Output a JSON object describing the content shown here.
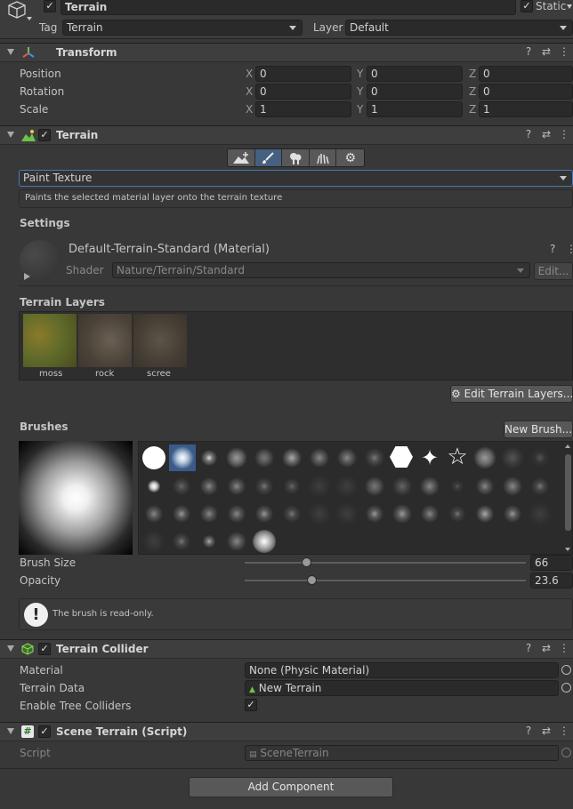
{
  "object": {
    "name": "Terrain",
    "static_label": "Static",
    "tag_label": "Tag",
    "tag_value": "Terrain",
    "layer_label": "Layer",
    "layer_value": "Default"
  },
  "transform": {
    "title": "Transform",
    "rows": [
      {
        "label": "Position",
        "x": "0",
        "y": "0",
        "z": "0"
      },
      {
        "label": "Rotation",
        "x": "0",
        "y": "0",
        "z": "0"
      },
      {
        "label": "Scale",
        "x": "1",
        "y": "1",
        "z": "1"
      }
    ],
    "axis_x": "X",
    "axis_y": "Y",
    "axis_z": "Z"
  },
  "terrain": {
    "title": "Terrain",
    "tool_dropdown": "Paint Texture",
    "tool_description": "Paints the selected material layer onto the terrain texture",
    "settings_label": "Settings",
    "material_name": "Default-Terrain-Standard (Material)",
    "shader_label": "Shader",
    "shader_value": "Nature/Terrain/Standard",
    "edit_label": "Edit...",
    "layers_label": "Terrain Layers",
    "layers": [
      {
        "name": "moss",
        "color": "#6b6a2a"
      },
      {
        "name": "rock",
        "color": "#5a5048"
      },
      {
        "name": "scree",
        "color": "#4e463c"
      }
    ],
    "edit_layers_label": "Edit Terrain Layers...",
    "brushes_label": "Brushes",
    "new_brush_label": "New Brush...",
    "brush_size_label": "Brush Size",
    "brush_size_value": "66",
    "brush_size_fraction": 0.22,
    "opacity_label": "Opacity",
    "opacity_value": "23.6",
    "opacity_fraction": 0.24,
    "readonly_message": "The brush is read-only."
  },
  "collider": {
    "title": "Terrain Collider",
    "material_label": "Material",
    "material_value": "None (Physic Material)",
    "data_label": "Terrain Data",
    "data_value": "New Terrain",
    "trees_label": "Enable Tree Colliders",
    "trees_checked": "✓"
  },
  "script": {
    "title": "Scene Terrain (Script)",
    "script_label": "Script",
    "script_value": "SceneTerrain"
  },
  "add_component_label": "Add Component",
  "colors": {
    "background": "#383838",
    "field": "#2a2a2a",
    "selected_tool": "#3a5a8a"
  }
}
